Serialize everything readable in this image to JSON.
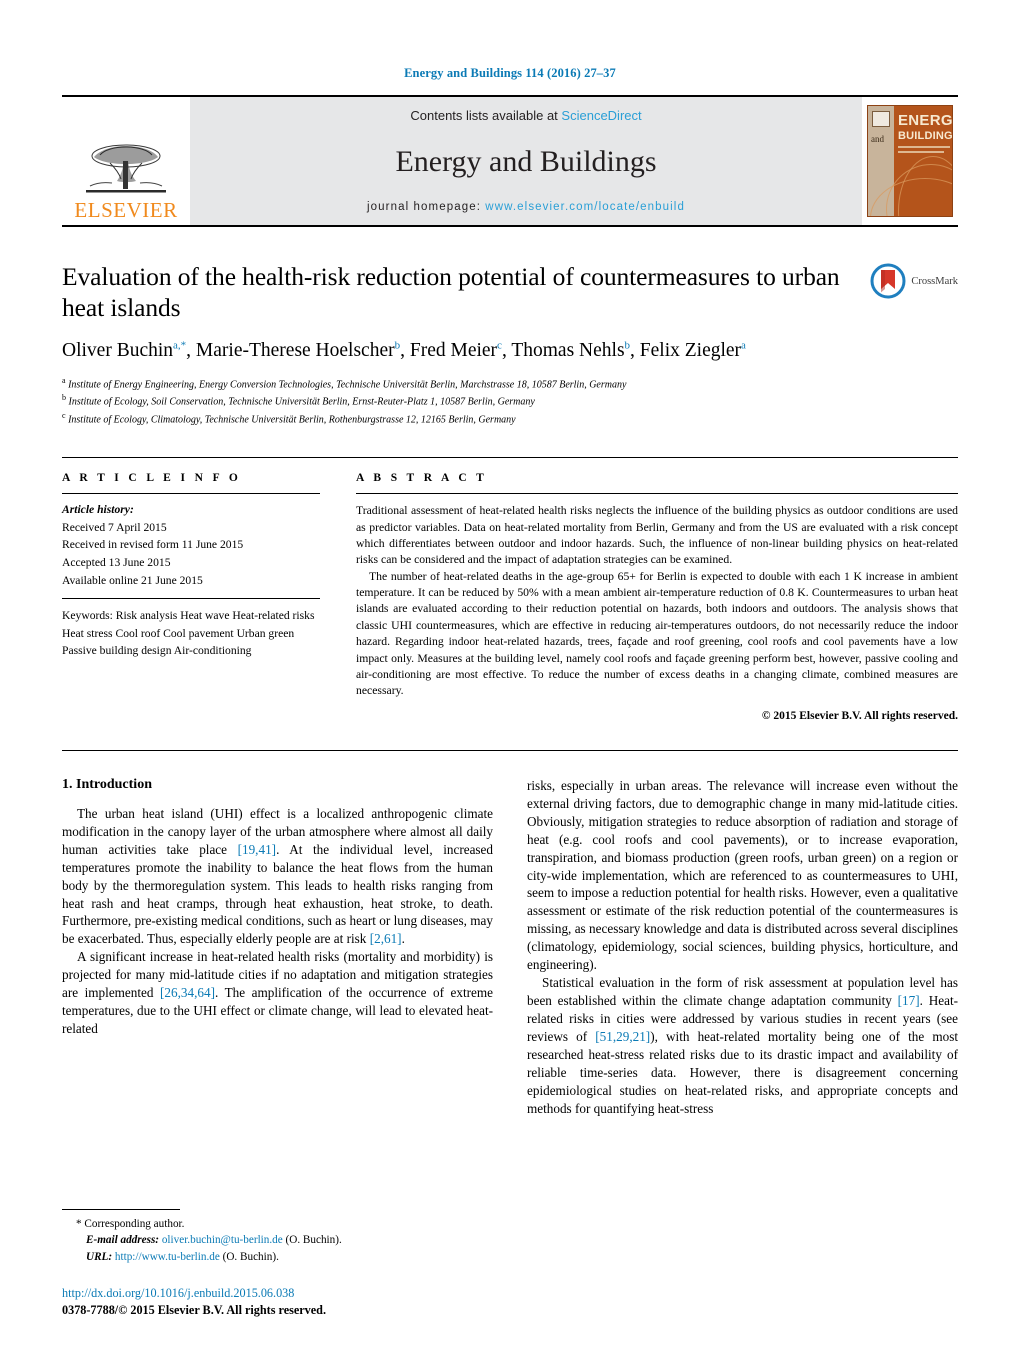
{
  "running_head": "Energy and Buildings 114 (2016) 27–37",
  "masthead": {
    "publisher": "ELSEVIER",
    "contents_prefix": "Contents lists available at",
    "contents_link": "ScienceDirect",
    "journal_name": "Energy and Buildings",
    "homepage_prefix": "journal homepage:",
    "homepage_url": "www.elsevier.com/locate/enbuild",
    "cover": {
      "and": "and",
      "energy": "ENERGY",
      "buildings": "BUILDINGS"
    },
    "link_color": "#2a9fd6",
    "elsevier_color": "#f08a1d"
  },
  "article": {
    "title": "Evaluation of the health-risk reduction potential of countermeasures to urban heat islands",
    "crossmark_label": "CrossMark",
    "authors_html": "Oliver Buchin<sup>a,*</sup>, Marie-Therese Hoelscher<sup>b</sup>, Fred Meier<sup>c</sup>, Thomas Nehls<sup>b</sup>, Felix Ziegler<sup>a</sup>",
    "affiliations": [
      "Institute of Energy Engineering, Energy Conversion Technologies, Technische Universität Berlin, Marchstrasse 18, 10587 Berlin, Germany",
      "Institute of Ecology, Soil Conservation, Technische Universität Berlin, Ernst-Reuter-Platz 1, 10587 Berlin, Germany",
      "Institute of Ecology, Climatology, Technische Universität Berlin, Rothenburgstrasse 12, 12165 Berlin, Germany"
    ],
    "affiliation_marks": [
      "a",
      "b",
      "c"
    ]
  },
  "article_info": {
    "heading": "A R T I C L E    I N F O",
    "history_label": "Article history:",
    "history": [
      "Received 7 April 2015",
      "Received in revised form 11 June 2015",
      "Accepted 13 June 2015",
      "Available online 21 June 2015"
    ],
    "keywords_label": "Keywords:",
    "keywords": [
      "Risk analysis",
      "Heat wave",
      "Heat-related risks",
      "Heat stress",
      "Cool roof",
      "Cool pavement",
      "Urban green",
      "Passive building design",
      "Air-conditioning"
    ]
  },
  "abstract": {
    "heading": "A B S T R A C T",
    "paragraphs": [
      "Traditional assessment of heat-related health risks neglects the influence of the building physics as outdoor conditions are used as predictor variables. Data on heat-related mortality from Berlin, Germany and from the US are evaluated with a risk concept which differentiates between outdoor and indoor hazards. Such, the influence of non-linear building physics on heat-related risks can be considered and the impact of adaptation strategies can be examined.",
      "The number of heat-related deaths in the age-group 65+ for Berlin is expected to double with each 1 K increase in ambient temperature. It can be reduced by 50% with a mean ambient air-temperature reduction of 0.8 K. Countermeasures to urban heat islands are evaluated according to their reduction potential on hazards, both indoors and outdoors. The analysis shows that classic UHI countermeasures, which are effective in reducing air-temperatures outdoors, do not necessarily reduce the indoor hazard. Regarding indoor heat-related hazards, trees, façade and roof greening, cool roofs and cool pavements have a low impact only. Measures at the building level, namely cool roofs and façade greening perform best, however, passive cooling and air-conditioning are most effective. To reduce the number of excess deaths in a changing climate, combined measures are necessary."
    ],
    "copyright": "© 2015 Elsevier B.V. All rights reserved."
  },
  "introduction": {
    "number_title": "1.  Introduction",
    "left_paragraphs_html": [
      "The urban heat island (UHI) effect is a localized anthropogenic climate modification in the canopy layer of the urban atmosphere where almost all daily human activities take place <span class=\"ref\">[19,41]</span>. At the individual level, increased temperatures promote the inability to balance the heat flows from the human body by the thermoregulation system. This leads to health risks ranging from heat rash and heat cramps, through heat exhaustion, heat stroke, to death. Furthermore, pre-existing medical conditions, such as heart or lung diseases, may be exacerbated. Thus, especially elderly people are at risk <span class=\"ref\">[2,61]</span>.",
      "A significant increase in heat-related health risks (mortality and morbidity) is projected for many mid-latitude cities if no adaptation and mitigation strategies are implemented <span class=\"ref\">[26,34,64]</span>. The amplification of the occurrence of extreme temperatures, due to the UHI effect or climate change, will lead to elevated heat-related"
    ],
    "right_paragraphs_html": [
      "risks, especially in urban areas. The relevance will increase even without the external driving factors, due to demographic change in many mid-latitude cities. Obviously, mitigation strategies to reduce absorption of radiation and storage of heat (e.g. cool roofs and cool pavements), or to increase evaporation, transpiration, and biomass production (green roofs, urban green) on a region or city-wide implementation, which are referenced to as countermeasures to UHI, seem to impose a reduction potential for health risks. However, even a qualitative assessment or estimate of the risk reduction potential of the countermeasures is missing, as necessary knowledge and data is distributed across several disciplines (climatology, epidemiology, social sciences, building physics, horticulture, and engineering).",
      "Statistical evaluation in the form of risk assessment at population level has been established within the climate change adaptation community <span class=\"ref\">[17]</span>. Heat-related risks in cities were addressed by various studies in recent years (see reviews of <span class=\"ref\">[51,29,21]</span>), with heat-related mortality being one of the most researched heat-stress related risks due to its drastic impact and availability of reliable time-series data. However, there is disagreement concerning epidemiological studies on heat-related risks, and appropriate concepts and methods for quantifying heat-stress"
    ]
  },
  "footnotes": {
    "corresponding": "*  Corresponding author.",
    "email_label": "E-mail address:",
    "email": "oliver.buchin@tu-berlin.de",
    "email_suffix": "(O. Buchin).",
    "url_label": "URL:",
    "url": "http://www.tu-berlin.de",
    "url_suffix": "(O. Buchin).",
    "doi": "http://dx.doi.org/10.1016/j.enbuild.2015.06.038",
    "issn": "0378-7788/© 2015 Elsevier B.V. All rights reserved."
  }
}
